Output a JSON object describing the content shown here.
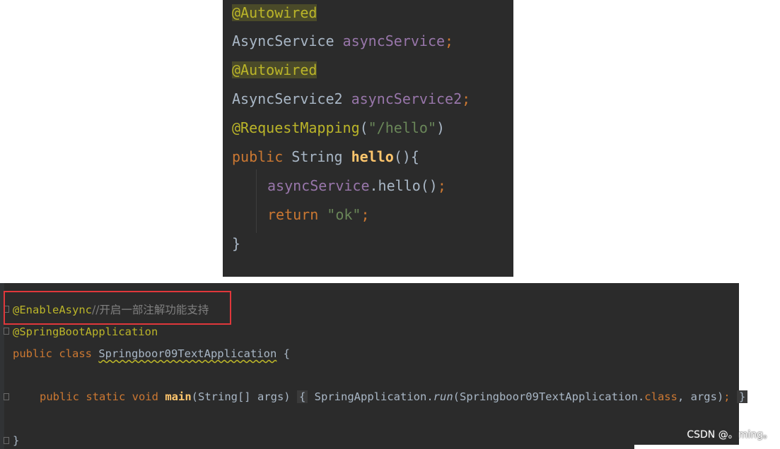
{
  "top_snippet": {
    "line1": {
      "annotation": "@Autowired"
    },
    "line2": {
      "type": "AsyncService",
      "field": "asyncService",
      "semicolon": ";"
    },
    "line3": {
      "annotation": "@Autowired"
    },
    "line4": {
      "type": "AsyncService2",
      "field": "asyncService2",
      "semicolon": ";"
    },
    "line5": {
      "annotation": "@RequestMapping",
      "paren_open": "(",
      "string": "\"/hello\"",
      "paren_close": ")"
    },
    "line6": {
      "keyword": "public",
      "type": "String",
      "method": "hello",
      "rest": "(){"
    },
    "line7": {
      "field": "asyncService",
      "rest": ".hello()",
      "semicolon": ";"
    },
    "line8": {
      "keyword": "return",
      "string": "\"ok\"",
      "semicolon": ";"
    },
    "line9": {
      "brace": "}"
    }
  },
  "bottom_snippet": {
    "line1": {
      "annotation": "@EnableAsync",
      "comment": "//开启一部注解功能支持"
    },
    "line2": {
      "annotation": "@SpringBootApplication"
    },
    "line3": {
      "keywords": "public class",
      "class_name": "Springboor09TextApplication",
      "brace": "{"
    },
    "line4": {
      "keywords": "public static void",
      "method": "main",
      "params": "(String[] args)",
      "brace_open": "{",
      "call_class": "SpringApplication",
      "dot": ".",
      "call_method": "run",
      "arg_open": "(Springboor09TextApplication.",
      "arg_kw": "class",
      "arg_rest": ", args)",
      "semicolon": ";",
      "brace_close": "}"
    },
    "line5": {
      "brace": "}"
    }
  },
  "watermark": "CSDN @。ming。",
  "colors": {
    "editor_bg": "#2b2b2b",
    "annotation": "#bbb529",
    "keyword": "#cc7832",
    "field": "#9876aa",
    "string": "#6a8759",
    "method_decl": "#ffc66d",
    "comment": "#808080",
    "default_text": "#a9b7c6",
    "highlight_box": "#e0373b"
  }
}
